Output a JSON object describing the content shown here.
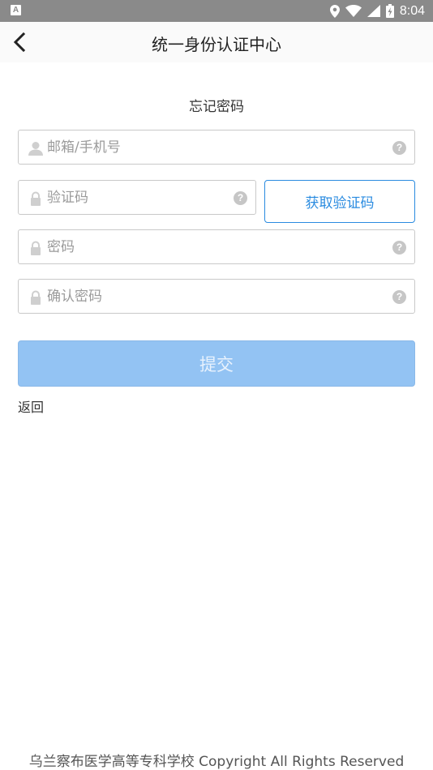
{
  "status_bar": {
    "time": "8:04",
    "app_indicator": "A"
  },
  "header": {
    "title": "统一身份认证中心",
    "back_icon": "chevron-left-icon"
  },
  "page": {
    "subtitle": "忘记密码"
  },
  "form": {
    "account": {
      "placeholder": "邮箱/手机号",
      "value": ""
    },
    "code": {
      "placeholder": "验证码",
      "value": ""
    },
    "get_code_label": "获取验证码",
    "password": {
      "placeholder": "密码",
      "value": ""
    },
    "confirm": {
      "placeholder": "确认密码",
      "value": ""
    },
    "help_glyph": "?",
    "submit_label": "提交",
    "back_link": "返回"
  },
  "footer": {
    "text": "乌兰察布医学高等专科学校 Copyright All Rights Reserved"
  },
  "colors": {
    "accent": "#2a8be0",
    "submit_bg": "#93c3f3",
    "status_bar": "#8a8a8a"
  }
}
